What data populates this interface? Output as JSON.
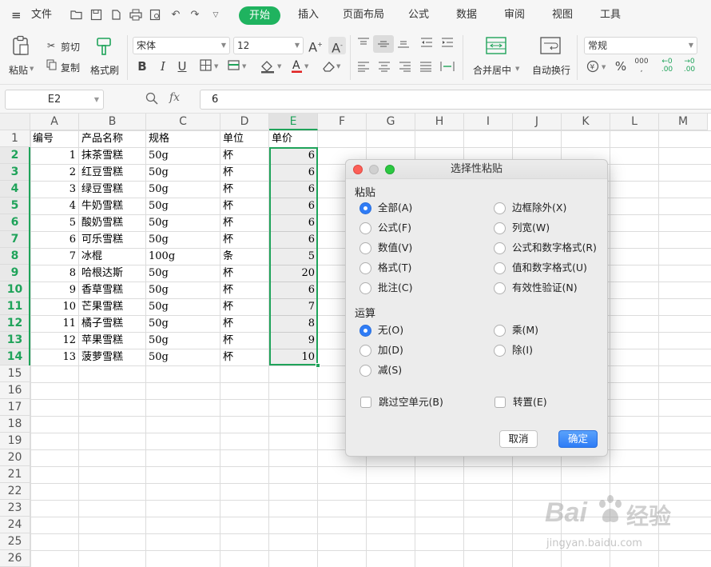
{
  "menubar": {
    "file_label": "文件",
    "tabs": [
      "开始",
      "插入",
      "页面布局",
      "公式",
      "数据",
      "审阅",
      "视图",
      "工具"
    ],
    "active_tab": "开始"
  },
  "ribbon": {
    "paste": "粘贴",
    "cut": "剪切",
    "copy": "复制",
    "format_painter": "格式刷",
    "font_name": "宋体",
    "font_size": "12",
    "merge_center": "合并居中",
    "wrap_text": "自动换行",
    "number_format": "常规"
  },
  "formula_bar": {
    "name_box": "E2",
    "fx_label": "fx",
    "value": "6"
  },
  "sheet": {
    "columns": [
      "A",
      "B",
      "C",
      "D",
      "E",
      "F",
      "G",
      "H",
      "I",
      "J",
      "K",
      "L",
      "M"
    ],
    "rows": [
      "1",
      "2",
      "3",
      "4",
      "5",
      "6",
      "7",
      "8",
      "9",
      "10",
      "11",
      "12",
      "13",
      "14",
      "15",
      "16",
      "17",
      "18",
      "19",
      "20",
      "21",
      "22",
      "23",
      "24",
      "25",
      "26"
    ],
    "header": [
      "编号",
      "产品名称",
      "规格",
      "单位",
      "单价"
    ],
    "data": [
      [
        "1",
        "抹茶雪糕",
        "50g",
        "杯",
        "6"
      ],
      [
        "2",
        "红豆雪糕",
        "50g",
        "杯",
        "6"
      ],
      [
        "3",
        "绿豆雪糕",
        "50g",
        "杯",
        "6"
      ],
      [
        "4",
        "牛奶雪糕",
        "50g",
        "杯",
        "6"
      ],
      [
        "5",
        "酸奶雪糕",
        "50g",
        "杯",
        "6"
      ],
      [
        "6",
        "可乐雪糕",
        "50g",
        "杯",
        "6"
      ],
      [
        "7",
        "冰棍",
        "100g",
        "条",
        "5"
      ],
      [
        "8",
        "哈根达斯",
        "50g",
        "杯",
        "20"
      ],
      [
        "9",
        "香草雪糕",
        "50g",
        "杯",
        "6"
      ],
      [
        "10",
        "芒果雪糕",
        "50g",
        "杯",
        "7"
      ],
      [
        "11",
        "橘子雪糕",
        "50g",
        "杯",
        "8"
      ],
      [
        "12",
        "苹果雪糕",
        "50g",
        "杯",
        "9"
      ],
      [
        "13",
        "菠萝雪糕",
        "50g",
        "杯",
        "10"
      ]
    ]
  },
  "dialog": {
    "title": "选择性粘贴",
    "paste_group": "粘贴",
    "paste_options_left": [
      "全部(A)",
      "公式(F)",
      "数值(V)",
      "格式(T)",
      "批注(C)"
    ],
    "paste_options_right": [
      "边框除外(X)",
      "列宽(W)",
      "公式和数字格式(R)",
      "值和数字格式(U)",
      "有效性验证(N)"
    ],
    "paste_selected": "全部(A)",
    "op_group": "运算",
    "op_options_left": [
      "无(O)",
      "加(D)",
      "减(S)"
    ],
    "op_options_right": [
      "乘(M)",
      "除(I)"
    ],
    "op_selected": "无(O)",
    "skip_blanks": "跳过空单元(B)",
    "transpose": "转置(E)",
    "cancel": "取消",
    "ok": "确定"
  },
  "watermark": {
    "brand": "Bai",
    "brand_cn": "经验",
    "url": "jingyan.baidu.com"
  },
  "colors": {
    "accent_green": "#1fb35f",
    "dialog_blue": "#2f7cf6"
  }
}
